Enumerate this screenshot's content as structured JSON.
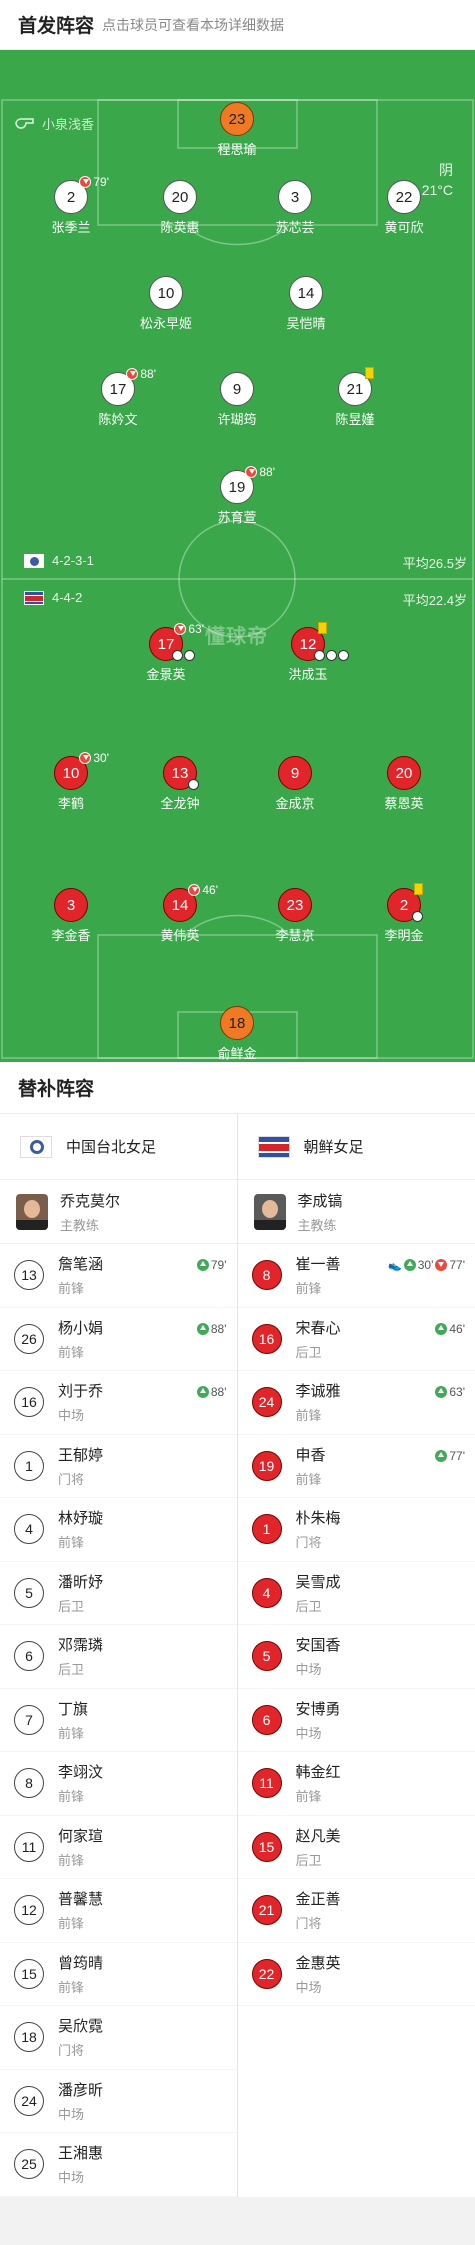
{
  "header": {
    "title": "首发阵容",
    "hint": "点击球员可查看本场详细数据"
  },
  "referee": {
    "name": "小泉浅香",
    "icon": "whistle-icon"
  },
  "weather": {
    "condition": "阴",
    "temp": "21°C"
  },
  "watermark": "懂球帝",
  "home": {
    "formation": "4-2-3-1",
    "avg_age": "平均26.5岁",
    "players": [
      {
        "num": "23",
        "name": "程思瑜"
      },
      {
        "num": "2",
        "name": "张季兰",
        "sub": "79'"
      },
      {
        "num": "20",
        "name": "陈英惠"
      },
      {
        "num": "3",
        "name": "苏芯芸"
      },
      {
        "num": "22",
        "name": "黄可欣"
      },
      {
        "num": "10",
        "name": "松永早姬"
      },
      {
        "num": "14",
        "name": "吴恺晴"
      },
      {
        "num": "17",
        "name": "陈妗文",
        "sub": "88'"
      },
      {
        "num": "9",
        "name": "许瑚筠"
      },
      {
        "num": "21",
        "name": "陈昱嫤"
      },
      {
        "num": "19",
        "name": "苏育萱",
        "sub": "88'"
      }
    ]
  },
  "away": {
    "formation": "4-4-2",
    "avg_age": "平均22.4岁",
    "players": [
      {
        "num": "17",
        "name": "金景英",
        "sub": "63'"
      },
      {
        "num": "12",
        "name": "洪成玉"
      },
      {
        "num": "10",
        "name": "李鹤",
        "sub": "30'"
      },
      {
        "num": "13",
        "name": "全龙钟"
      },
      {
        "num": "9",
        "name": "金成京"
      },
      {
        "num": "20",
        "name": "蔡恩英"
      },
      {
        "num": "3",
        "name": "李金香"
      },
      {
        "num": "14",
        "name": "黄伟英",
        "sub": "46'"
      },
      {
        "num": "23",
        "name": "李慧京"
      },
      {
        "num": "2",
        "name": "李明金"
      },
      {
        "num": "18",
        "name": "俞鲜金"
      }
    ]
  },
  "subs_title": "替补阵容",
  "left": {
    "team": "中国台北女足",
    "coach": {
      "name": "乔克莫尔",
      "role": "主教练"
    },
    "subs": [
      {
        "num": "13",
        "name": "詹笔涵",
        "pos": "前锋",
        "evt": "79'"
      },
      {
        "num": "26",
        "name": "杨小娟",
        "pos": "前锋",
        "evt": "88'"
      },
      {
        "num": "16",
        "name": "刘于乔",
        "pos": "中场",
        "evt": "88'"
      },
      {
        "num": "1",
        "name": "王郁婷",
        "pos": "门将"
      },
      {
        "num": "4",
        "name": "林妤璇",
        "pos": "前锋"
      },
      {
        "num": "5",
        "name": "潘昕妤",
        "pos": "后卫"
      },
      {
        "num": "6",
        "name": "邓霈璘",
        "pos": "后卫"
      },
      {
        "num": "7",
        "name": "丁旗",
        "pos": "前锋"
      },
      {
        "num": "8",
        "name": "李翊汶",
        "pos": "前锋"
      },
      {
        "num": "11",
        "name": "何家瑄",
        "pos": "前锋"
      },
      {
        "num": "12",
        "name": "普馨慧",
        "pos": "前锋"
      },
      {
        "num": "15",
        "name": "曾筠晴",
        "pos": "前锋"
      },
      {
        "num": "18",
        "name": "吴欣霓",
        "pos": "门将"
      },
      {
        "num": "24",
        "name": "潘彦昕",
        "pos": "中场"
      },
      {
        "num": "25",
        "name": "王湘惠",
        "pos": "中场"
      }
    ]
  },
  "right": {
    "team": "朝鲜女足",
    "coach": {
      "name": "李成镐",
      "role": "主教练"
    },
    "subs": [
      {
        "num": "8",
        "name": "崔一善",
        "pos": "前锋",
        "evt": "30'",
        "evt2": "77'"
      },
      {
        "num": "16",
        "name": "宋春心",
        "pos": "后卫",
        "evt": "46'"
      },
      {
        "num": "24",
        "name": "李诚雅",
        "pos": "前锋",
        "evt": "63'"
      },
      {
        "num": "19",
        "name": "申香",
        "pos": "前锋",
        "evt": "77'"
      },
      {
        "num": "1",
        "name": "朴朱梅",
        "pos": "门将"
      },
      {
        "num": "4",
        "name": "吴雪成",
        "pos": "后卫"
      },
      {
        "num": "5",
        "name": "安国香",
        "pos": "中场"
      },
      {
        "num": "6",
        "name": "安博勇",
        "pos": "中场"
      },
      {
        "num": "11",
        "name": "韩金红",
        "pos": "前锋"
      },
      {
        "num": "15",
        "name": "赵凡美",
        "pos": "后卫"
      },
      {
        "num": "21",
        "name": "金正善",
        "pos": "门将"
      },
      {
        "num": "22",
        "name": "金惠英",
        "pos": "中场"
      }
    ]
  }
}
